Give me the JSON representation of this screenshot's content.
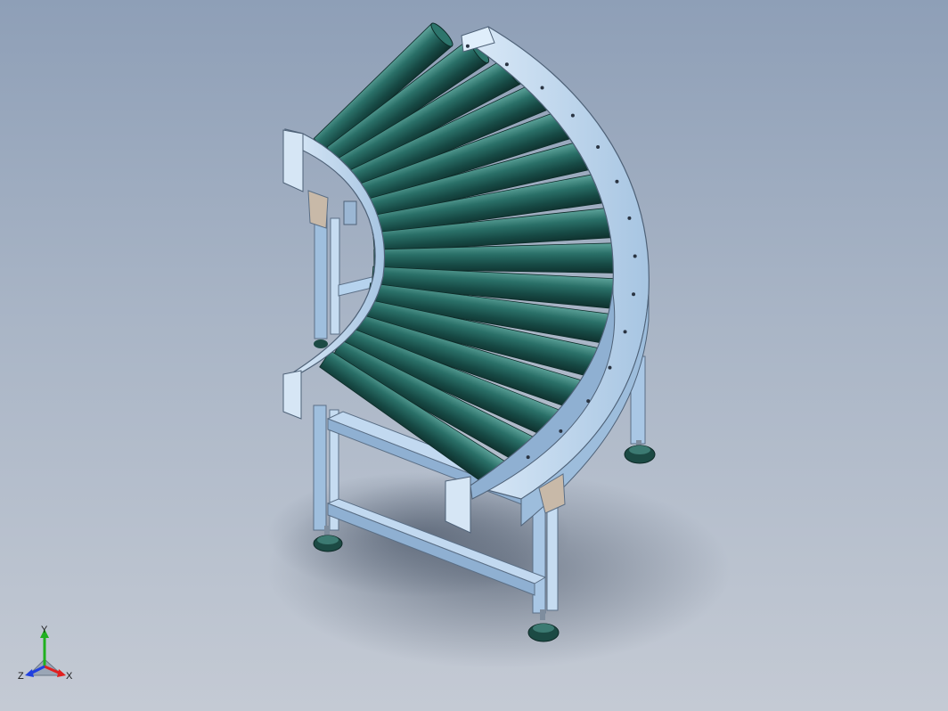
{
  "viewport": {
    "background_top": "#8e9fb7",
    "background_bottom": "#c4cad4"
  },
  "model": {
    "roller_color": "#1f5f5a",
    "frame_color": "#b6d3ee",
    "foot_color": "#1c4a44",
    "roller_count": 16
  },
  "triad": {
    "x_label": "X",
    "y_label": "Y",
    "z_label": "Z",
    "x_color": "#e02020",
    "y_color": "#20b020",
    "z_color": "#2040e0"
  }
}
